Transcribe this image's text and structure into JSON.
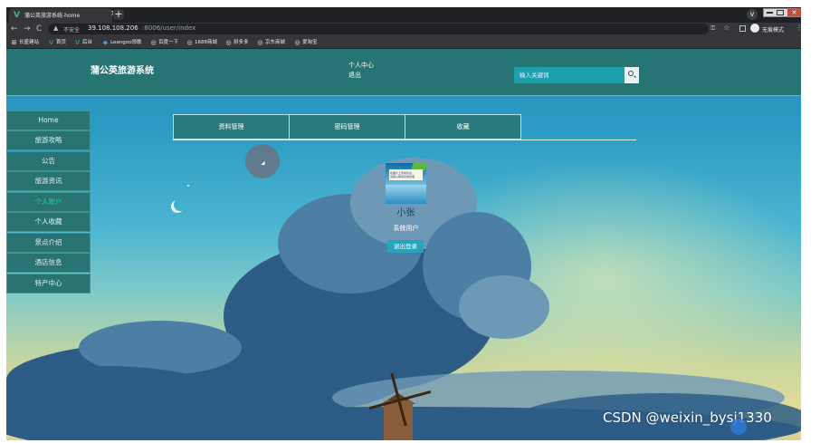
{
  "browser": {
    "tab_title": "蒲公英旅游系统-home",
    "tab_close": "×",
    "new_tab": "+",
    "profile_letter": "v",
    "window_close": "✕",
    "nav": {
      "back": "←",
      "forward": "→",
      "reload": "C"
    },
    "insecure_label": "不安全",
    "url_host": "39.108.108.206",
    "url_rest": ":8006/user/index",
    "incognito_label": "无痕模式",
    "menu": "⋮",
    "bookmarks": [
      {
        "icon": "apps-icon",
        "glyph": "⊞",
        "label": "长盛建站"
      },
      {
        "icon": "vue-icon",
        "glyph": "V",
        "label": "首页"
      },
      {
        "icon": "vue-icon",
        "glyph": "V",
        "label": "后台"
      },
      {
        "icon": "diamond-icon",
        "glyph": "◆",
        "label": "Leangoo领歌"
      },
      {
        "icon": "globe-icon",
        "glyph": "◎",
        "label": "百度一下"
      },
      {
        "icon": "globe-icon",
        "glyph": "◎",
        "label": "1688商城"
      },
      {
        "icon": "globe-icon",
        "glyph": "◎",
        "label": "拼多多"
      },
      {
        "icon": "globe-icon",
        "glyph": "◎",
        "label": "京东商城"
      },
      {
        "icon": "globe-icon",
        "glyph": "◎",
        "label": "爱淘宝"
      }
    ]
  },
  "header": {
    "logo": "蒲公英旅游系统",
    "user_center": "个人中心",
    "logout": "退出",
    "search_placeholder": "输入关键词"
  },
  "sidebar": {
    "items": [
      {
        "label": "Home",
        "active": false
      },
      {
        "label": "旅游攻略",
        "active": false
      },
      {
        "label": "公告",
        "active": false
      },
      {
        "label": "旅游资讯",
        "active": false
      },
      {
        "label": "个人账户",
        "active": true
      },
      {
        "label": "个人收藏",
        "active": false
      },
      {
        "label": "景点介绍",
        "active": false
      },
      {
        "label": "酒店信息",
        "active": false
      },
      {
        "label": "特产中心",
        "active": false
      }
    ]
  },
  "tabs": [
    {
      "label": "资料管理"
    },
    {
      "label": "密码管理"
    },
    {
      "label": "收藏"
    }
  ],
  "profile": {
    "avatar_text_1": "在图片上传成功后",
    "avatar_text_2": "请耐心等待系统处理",
    "username": "小张",
    "role": "系统用户",
    "logout_button": "退出登录"
  },
  "watermark": "CSDN @weixin_bysj1330",
  "colors": {
    "header": "#277474",
    "sidebar": "#2a7373",
    "active_item": "#23d39a",
    "tab": "#2a7b7e",
    "button": "#27a4bd"
  }
}
